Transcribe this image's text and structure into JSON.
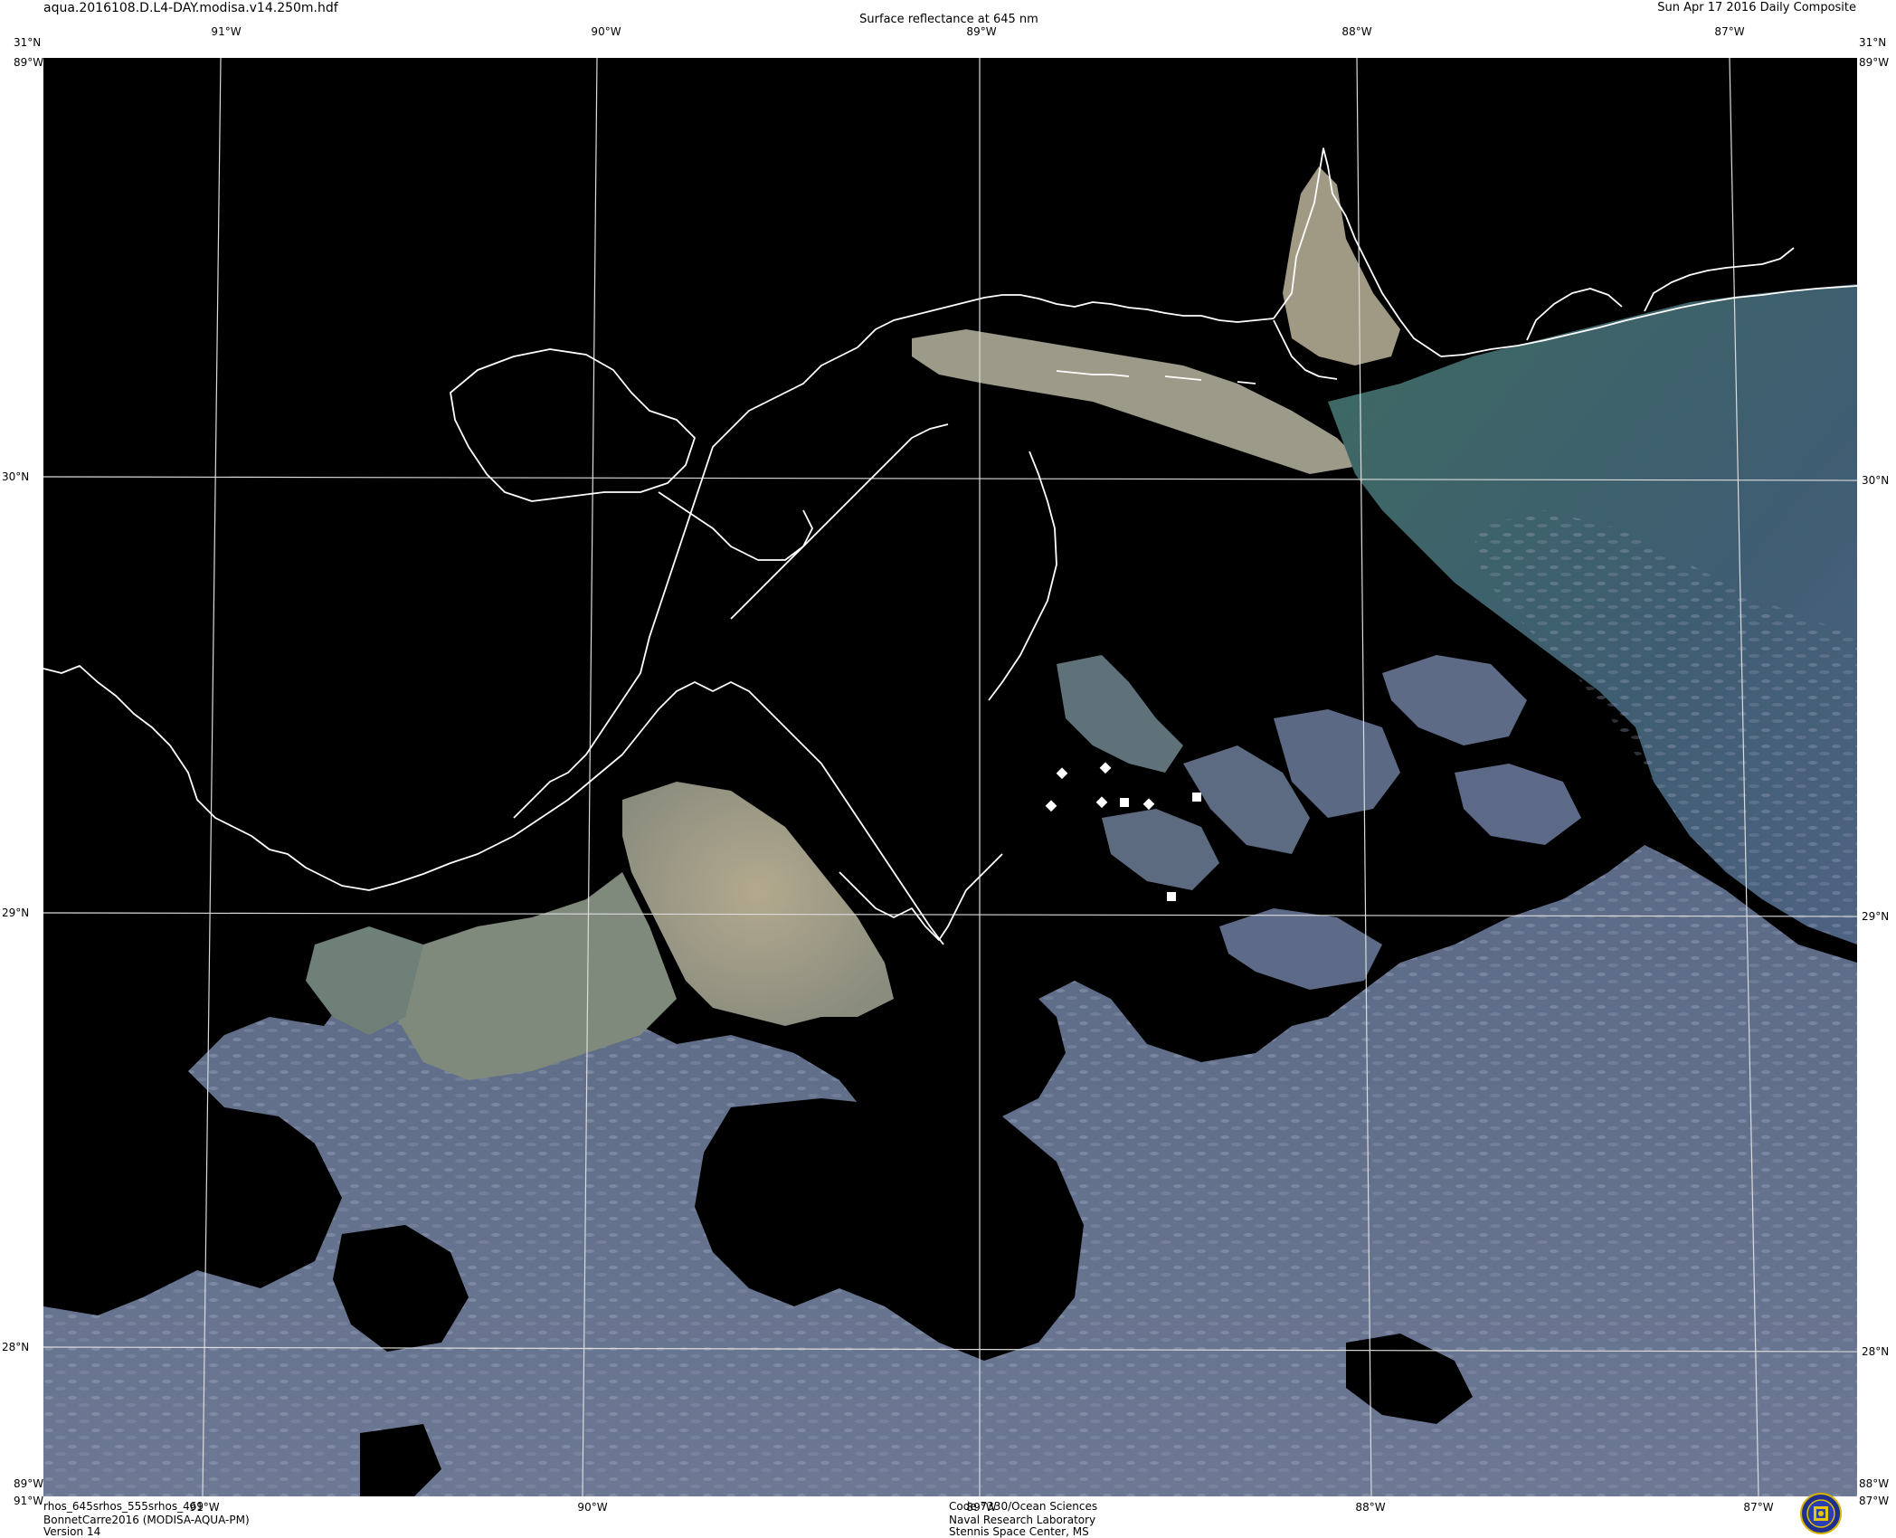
{
  "header": {
    "filename": "aqua.2016108.D.L4-DAY.modisa.v14.250m.hdf",
    "product_title": "Surface reflectance at 645 nm",
    "date_label": "Sun Apr 17 2016 Daily Composite"
  },
  "graticule": {
    "longitude_labels": [
      "91°W",
      "90°W",
      "89°W",
      "88°W",
      "87°W"
    ],
    "latitude_labels": [
      "31°N",
      "30°N",
      "29°N",
      "28°N"
    ],
    "corner_labels": {
      "top_left_lat": "31°N",
      "top_left_lon": "89°W",
      "top_right_lat": "31°N",
      "top_right_lon": "89°W",
      "bottom_left_lat": "89°W",
      "bottom_left_lon": "91°W",
      "bottom_right_lat": "88°W",
      "bottom_right_lon": "87°W"
    }
  },
  "footer_left": {
    "bands": "rhos_645srhos_555srhos_469",
    "dataset": "BonnetCarre2016 (MODISA-AQUA-PM)",
    "version": "Version 14"
  },
  "footer_center": {
    "code": "Code 7330/Ocean Sciences",
    "lab": "Naval Research Laboratory",
    "location": "Stennis Space Center, MS"
  },
  "colors": {
    "no_data": "#000000",
    "sediment_plume": "#a69e86",
    "gulf_water_blue": "#5e6d88",
    "nearshore_green": "#3f6a66",
    "coastline": "#ffffff",
    "graticule": "#dcdcdc"
  },
  "icons": {
    "seal": "nrl-seal-icon"
  }
}
